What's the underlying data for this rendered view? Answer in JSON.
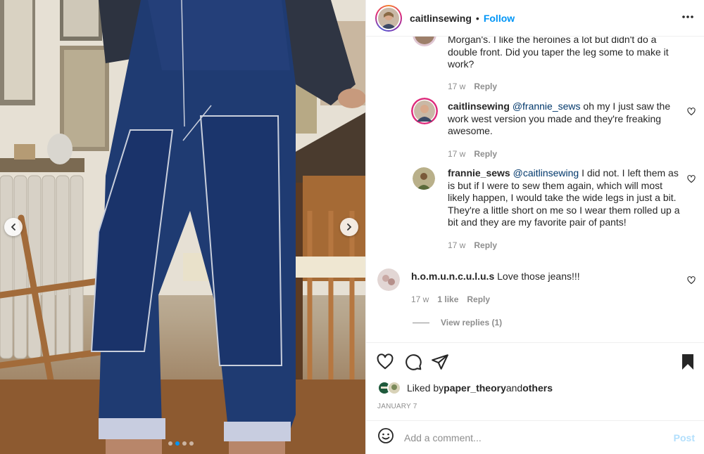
{
  "post": {
    "username": "caitlinsewing",
    "separator": "•",
    "follow_label": "Follow",
    "more_icon": "more-horizontal-icon"
  },
  "photo": {
    "prev_icon": "chevron-left-icon",
    "next_icon": "chevron-right-icon",
    "slide_count": 4,
    "active_slide": 2
  },
  "comments": [
    {
      "id": "c1-partial",
      "text": "Morgan's. I like the heroines a lot but didn't do a double front. Did you taper the leg some to make it work?",
      "time": "17 w",
      "reply_label": "Reply"
    },
    {
      "id": "c2",
      "username": "caitlinsewing",
      "mention": "@frannie_sews",
      "text": " oh my I just saw the work west version you made and they're freaking awesome.",
      "time": "17 w",
      "reply_label": "Reply"
    },
    {
      "id": "c3",
      "username": "frannie_sews",
      "mention": "@caitlinsewing",
      "text": " I did not. I left them as is but if I were to sew them again, which will most likely happen, I would take the wide legs in just a bit. They're a little short on me so I wear them rolled up a bit and they are my favorite pair of pants!",
      "time": "17 w",
      "reply_label": "Reply"
    },
    {
      "id": "c4",
      "username": "h.o.m.u.n.c.u.l.u.s",
      "text": " Love those jeans!!!",
      "time": "17 w",
      "likes": "1 like",
      "reply_label": "Reply",
      "view_replies": "View replies (1)"
    }
  ],
  "actions": {
    "like_icon": "heart-icon",
    "comment_icon": "comment-icon",
    "share_icon": "send-icon",
    "save_icon": "bookmark-icon",
    "liked_prefix": "Liked by ",
    "liked_user": "paper_theory",
    "liked_mid": " and ",
    "liked_others": "others",
    "date": "JANUARY 7"
  },
  "composer": {
    "emoji_icon": "smiley-icon",
    "placeholder": "Add a comment...",
    "post_label": "Post"
  },
  "colors": {
    "accent": "#0095f6",
    "text": "#262626",
    "muted": "#8e8e8e",
    "post_disabled": "#b2dffc",
    "denim": "#1f3b72"
  }
}
